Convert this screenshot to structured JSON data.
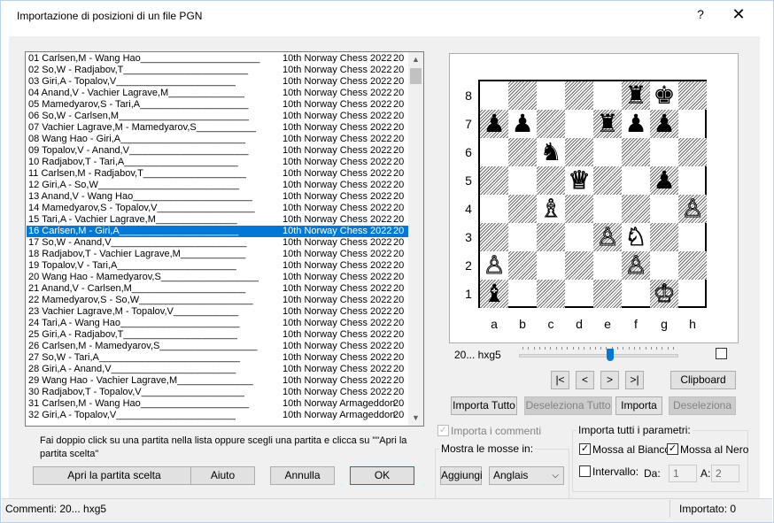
{
  "window": {
    "title": "Importazione di posizioni  di un file PGN",
    "help_label": "?",
    "close_label": "✕"
  },
  "games": [
    {
      "game": "01 Carlsen,M - Wang Hao______________________",
      "event": "10th Norway Chess 2022",
      "year": "20"
    },
    {
      "game": "02 So,W - Radjabov,T_______________________",
      "event": "10th Norway Chess 2022",
      "year": "20"
    },
    {
      "game": "03 Giri,A - Topalov,V______________________",
      "event": "10th Norway Chess 2022",
      "year": "20"
    },
    {
      "game": "04 Anand,V - Vachier Lagrave,M______________",
      "event": "10th Norway Chess 2022",
      "year": "20"
    },
    {
      "game": "05 Mamedyarov,S - Tari,A____________________",
      "event": "10th Norway Chess 2022",
      "year": "20"
    },
    {
      "game": "06 So,W - Carlsen,M________________________",
      "event": "10th Norway Chess 2022",
      "year": "20"
    },
    {
      "game": "07 Vachier Lagrave,M - Mamedyarov,S___________",
      "event": "10th Norway Chess 2022",
      "year": "20"
    },
    {
      "game": "08 Wang Hao - Giri,A_______________________",
      "event": "10th Norway Chess 2022",
      "year": "20"
    },
    {
      "game": "09 Topalov,V - Anand,V______________________",
      "event": "10th Norway Chess 2022",
      "year": "20"
    },
    {
      "game": "10 Radjabov,T - Tari,A_____________________",
      "event": "10th Norway Chess 2022",
      "year": "20"
    },
    {
      "game": "11 Carlsen,M - Radjabov,T___________________",
      "event": "10th Norway Chess 2022",
      "year": "20"
    },
    {
      "game": "12 Giri,A - So,W__________________________",
      "event": "10th Norway Chess 2022",
      "year": "20"
    },
    {
      "game": "13 Anand,V - Wang Hao______________________",
      "event": "10th Norway Chess 2022",
      "year": "20"
    },
    {
      "game": "14 Mamedyarov,S - Topalov,V__________________",
      "event": "10th Norway Chess 2022",
      "year": "20"
    },
    {
      "game": "15 Tari,A - Vachier Lagrave,M_______________",
      "event": "10th Norway Chess 2022",
      "year": "20"
    },
    {
      "game": "16 Carlsen,M - Giri,A______________________",
      "event": "10th Norway Chess 2022",
      "year": "20"
    },
    {
      "game": "17 So,W - Anand,V_________________________",
      "event": "10th Norway Chess 2022",
      "year": "20"
    },
    {
      "game": "18 Radjabov,T - Vachier Lagrave,M____________",
      "event": "10th Norway Chess 2022",
      "year": "20"
    },
    {
      "game": "19 Topalov,V - Tari,A______________________",
      "event": "10th Norway Chess 2022",
      "year": "20"
    },
    {
      "game": "20 Wang Hao - Mamedyarov,S__________________",
      "event": "10th Norway Chess 2022",
      "year": "20"
    },
    {
      "game": "21 Anand,V - Carlsen,M_____________________",
      "event": "10th Norway Chess 2022",
      "year": "20"
    },
    {
      "game": "22 Mamedyarov,S - So,W_____________________",
      "event": "10th Norway Chess 2022",
      "year": "20"
    },
    {
      "game": "23 Vachier Lagrave,M - Topalov,V____________",
      "event": "10th Norway Chess 2022",
      "year": "20"
    },
    {
      "game": "24 Tari,A - Wang Hao______________________",
      "event": "10th Norway Chess 2022",
      "year": "20"
    },
    {
      "game": "25 Giri,A - Radjabov,T_____________________",
      "event": "10th Norway Chess 2022",
      "year": "20"
    },
    {
      "game": "26 Carlsen,M - Mamedyarov,S__________________",
      "event": "10th Norway Chess 2022",
      "year": "20"
    },
    {
      "game": "27 So,W - Tari,A__________________________",
      "event": "10th Norway Chess 2022",
      "year": "20"
    },
    {
      "game": "28 Giri,A - Anand,V_______________________",
      "event": "10th Norway Chess 2022",
      "year": "20"
    },
    {
      "game": "29 Wang Hao - Vachier Lagrave,M______________",
      "event": "10th Norway Chess 2022",
      "year": "20"
    },
    {
      "game": "30 Radjabov,T - Topalov,V___________________",
      "event": "10th Norway Chess 2022",
      "year": "20"
    },
    {
      "game": "31 Carlsen,M - Wang Hao____________________",
      "event": "10th Norway Armageddon",
      "year": "20"
    },
    {
      "game": "32 Giri,A - Topalov,V______________________",
      "event": "10th Norway Armageddon",
      "year": "20"
    }
  ],
  "selected_index": 15,
  "scroll": {
    "up": "▲",
    "down": "▼"
  },
  "hint": "Fai doppio click su una partita nella lista oppure scegli una partita e clicca su \"\"Apri la partita scelta\"",
  "buttons": {
    "open": "Apri la partita scelta",
    "help": "Aiuto",
    "cancel": "Annulla",
    "ok": "OK",
    "first": "|<",
    "prev": "<",
    "next": ">",
    "last": ">|",
    "clipboard": "Clipboard",
    "import_all": "Importa Tutto",
    "deselect_all": "Deseleziona Tutto",
    "import": "Importa",
    "deselect": "Deseleziona",
    "add": "Aggiungi"
  },
  "board": {
    "ranks": [
      "8",
      "7",
      "6",
      "5",
      "4",
      "3",
      "2",
      "1"
    ],
    "files": [
      "a",
      "b",
      "c",
      "d",
      "e",
      "f",
      "g",
      "h"
    ],
    "pieces": [
      {
        "sq": "f8",
        "glyph": "♜",
        "color": "b",
        "name": "black-rook-icon"
      },
      {
        "sq": "g8",
        "glyph": "♚",
        "color": "b",
        "name": "black-king-icon"
      },
      {
        "sq": "a7",
        "glyph": "♟",
        "color": "b",
        "name": "black-pawn-icon"
      },
      {
        "sq": "b7",
        "glyph": "♟",
        "color": "b",
        "name": "black-pawn-icon"
      },
      {
        "sq": "e7",
        "glyph": "♜",
        "color": "b",
        "name": "black-rook-icon"
      },
      {
        "sq": "f7",
        "glyph": "♟",
        "color": "b",
        "name": "black-pawn-icon"
      },
      {
        "sq": "g7",
        "glyph": "♟",
        "color": "b",
        "name": "black-pawn-icon"
      },
      {
        "sq": "c6",
        "glyph": "♞",
        "color": "b",
        "name": "black-knight-icon"
      },
      {
        "sq": "d5",
        "glyph": "♕",
        "color": "w",
        "name": "white-queen-icon"
      },
      {
        "sq": "g5",
        "glyph": "♟",
        "color": "b",
        "name": "black-pawn-icon"
      },
      {
        "sq": "c4",
        "glyph": "♗",
        "color": "w",
        "name": "white-bishop-icon"
      },
      {
        "sq": "h4",
        "glyph": "♙",
        "color": "w",
        "name": "white-pawn-icon"
      },
      {
        "sq": "e3",
        "glyph": "♙",
        "color": "w",
        "name": "white-pawn-icon"
      },
      {
        "sq": "f3",
        "glyph": "♘",
        "color": "w",
        "name": "white-knight-icon"
      },
      {
        "sq": "a2",
        "glyph": "♙",
        "color": "w",
        "name": "white-pawn-icon"
      },
      {
        "sq": "f2",
        "glyph": "♙",
        "color": "w",
        "name": "white-pawn-icon"
      },
      {
        "sq": "a1",
        "glyph": "♝",
        "color": "b",
        "name": "black-bishop-icon"
      },
      {
        "sq": "g1",
        "glyph": "♔",
        "color": "w",
        "name": "white-king-icon"
      }
    ]
  },
  "move_label": "20... hxg5",
  "slider": {
    "ticks": 28,
    "position": 0.58
  },
  "import_comments": {
    "label": "Importa i commenti",
    "checked": true,
    "check": "✓"
  },
  "show_moves": {
    "label": "Mostra le mosse in:",
    "selected": "Anglais",
    "arrow": "⌵"
  },
  "params": {
    "label": "Importa tutti i parametri:",
    "white_move": {
      "label": "Mossa al Bianco",
      "checked": true
    },
    "black_move": {
      "label": "Mossa al Nero",
      "checked": true
    },
    "interval": {
      "label": "Intervallo:",
      "checked": false
    },
    "from_label": "Da:",
    "from_value": "1",
    "to_label": "A:",
    "to_value": "2",
    "check": "✓"
  },
  "status": {
    "comments": "Commenti: 20... hxg5",
    "imported": "Importato: 0"
  }
}
